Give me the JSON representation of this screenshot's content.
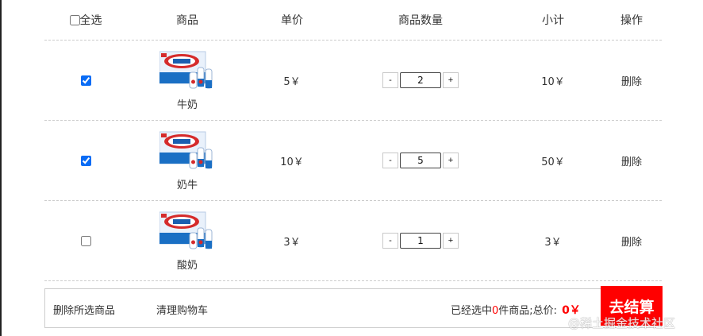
{
  "header": {
    "select_all_label": "全选",
    "goods": "商品",
    "price": "单价",
    "quantity": "商品数量",
    "subtotal": "小计",
    "operation": "操作"
  },
  "items": [
    {
      "name": "牛奶",
      "price": "5￥",
      "quantity": "2",
      "subtotal": "10￥",
      "action": "删除",
      "checked": true
    },
    {
      "name": "奶牛",
      "price": "10￥",
      "quantity": "5",
      "subtotal": "50￥",
      "action": "删除",
      "checked": true
    },
    {
      "name": "酸奶",
      "price": "3￥",
      "quantity": "1",
      "subtotal": "3￥",
      "action": "删除",
      "checked": false
    }
  ],
  "qty_minus": "-",
  "qty_plus": "+",
  "footer": {
    "delete_selected": "删除所选商品",
    "clear_cart": "清理购物车",
    "summary_prefix": "已经选中",
    "selected_count": "0",
    "summary_suffix": "件商品;总价:",
    "total": "0￥",
    "checkout": "去结算"
  },
  "watermark": "@稀土掘金技术社区",
  "colors": {
    "accent": "#ff0000",
    "checkbox": "#0a6cf5"
  }
}
